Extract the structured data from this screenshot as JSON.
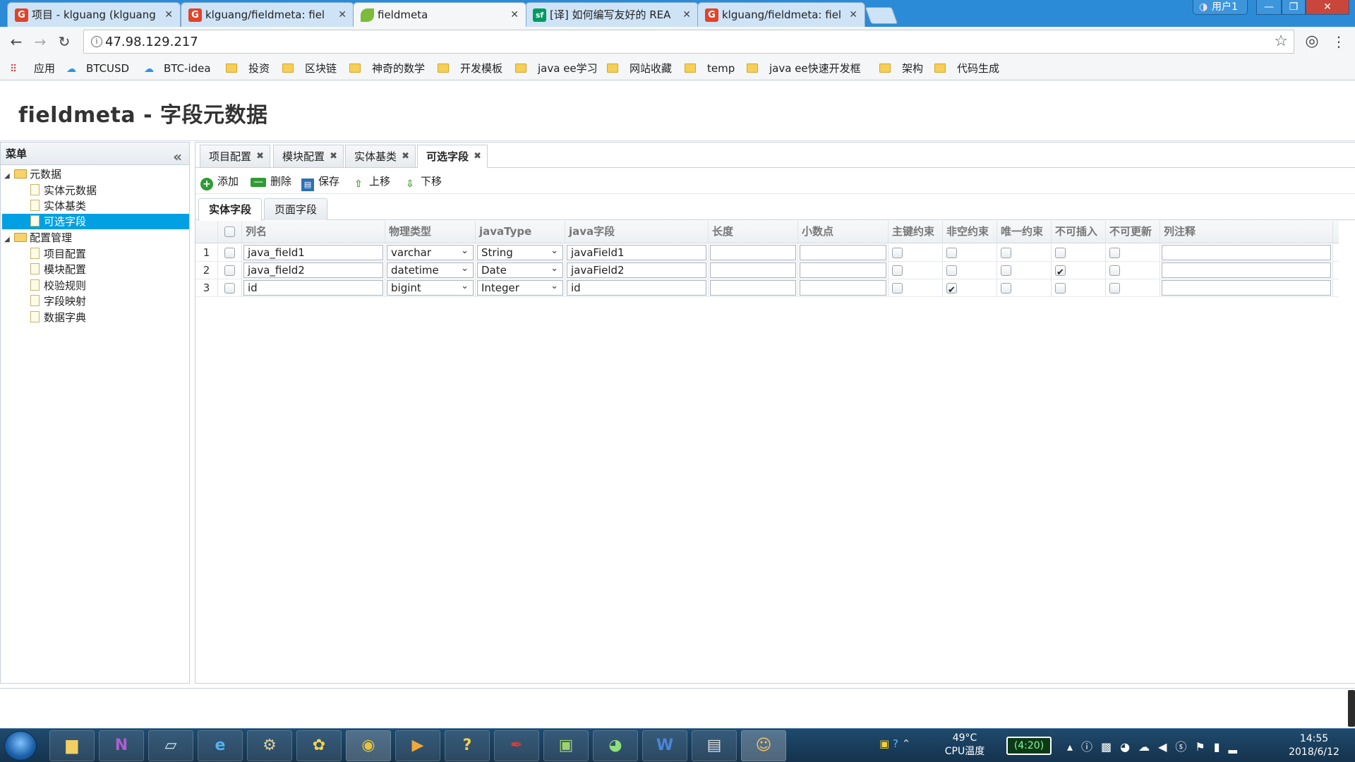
{
  "browser": {
    "tabs": [
      {
        "title": "项目 - klguang (klguang",
        "icon_text": "G",
        "icon_color": "#e24329"
      },
      {
        "title": "klguang/fieldmeta: fiel",
        "icon_text": "G",
        "icon_color": "#e24329"
      },
      {
        "title": "fieldmeta",
        "icon_text": "",
        "icon_color": "#7cbc3a"
      },
      {
        "title": "[译] 如何编写友好的 REA",
        "icon_text": "sf",
        "icon_color": "#009a61"
      },
      {
        "title": "klguang/fieldmeta: fiel",
        "icon_text": "G",
        "icon_color": "#e24329"
      }
    ],
    "user_label": "用户1",
    "url": "47.98.129.217",
    "bookmarks": [
      {
        "label": "应用",
        "kind": "apps"
      },
      {
        "label": "BTCUSD",
        "kind": "cloud"
      },
      {
        "label": "BTC-idea",
        "kind": "cloud"
      },
      {
        "label": "投资",
        "kind": "folder"
      },
      {
        "label": "区块链",
        "kind": "folder"
      },
      {
        "label": "神奇的数学",
        "kind": "folder"
      },
      {
        "label": "开发模板",
        "kind": "folder"
      },
      {
        "label": "java ee学习",
        "kind": "folder"
      },
      {
        "label": "网站收藏",
        "kind": "folder"
      },
      {
        "label": "temp",
        "kind": "folder"
      },
      {
        "label": "java ee快速开发框",
        "kind": "folder"
      },
      {
        "label": "架构",
        "kind": "folder"
      },
      {
        "label": "代码生成",
        "kind": "folder"
      }
    ]
  },
  "page": {
    "title": "fieldmeta - 字段元数据"
  },
  "sidebar": {
    "header": "菜单",
    "groups": [
      {
        "label": "元数据",
        "items": [
          "实体元数据",
          "实体基类",
          "可选字段"
        ]
      },
      {
        "label": "配置管理",
        "items": [
          "项目配置",
          "模块配置",
          "校验规则",
          "字段映射",
          "数据字典"
        ]
      }
    ],
    "selected": "可选字段"
  },
  "content_tabs": [
    "项目配置",
    "模块配置",
    "实体基类",
    "可选字段"
  ],
  "active_tab": "可选字段",
  "toolbar": {
    "add": "添加",
    "delete": "删除",
    "save": "保存",
    "move_up": "上移",
    "move_down": "下移"
  },
  "sub_tabs": [
    "实体字段",
    "页面字段"
  ],
  "grid": {
    "columns": [
      "列名",
      "物理类型",
      "javaType",
      "java字段",
      "长度",
      "小数点",
      "主键约束",
      "非空约束",
      "唯一约束",
      "不可插入",
      "不可更新",
      "列注释"
    ],
    "rows": [
      {
        "num": "1",
        "col_name": "java_field1",
        "phys_type": "varchar",
        "java_type": "String",
        "java_field": "javaField1",
        "length": "",
        "decimal": "",
        "pk": false,
        "not_null": false,
        "unique": false,
        "no_insert": false,
        "no_update": false,
        "comment": ""
      },
      {
        "num": "2",
        "col_name": "java_field2",
        "phys_type": "datetime",
        "java_type": "Date",
        "java_field": "javaField2",
        "length": "",
        "decimal": "",
        "pk": false,
        "not_null": false,
        "unique": false,
        "no_insert": true,
        "no_update": false,
        "comment": ""
      },
      {
        "num": "3",
        "col_name": "id",
        "phys_type": "bigint",
        "java_type": "Integer",
        "java_field": "id",
        "length": "",
        "decimal": "",
        "pk": false,
        "not_null": true,
        "unique": false,
        "no_insert": false,
        "no_update": false,
        "comment": ""
      }
    ]
  },
  "taskbar": {
    "tray_temp": "49°C",
    "tray_temp_label": "CPU温度",
    "battery": "(4:20)",
    "time": "14:55",
    "date": "2018/6/12"
  },
  "colors": {
    "selected_tree": "#00a0e3",
    "tabstrip": "#2c8bd6"
  }
}
